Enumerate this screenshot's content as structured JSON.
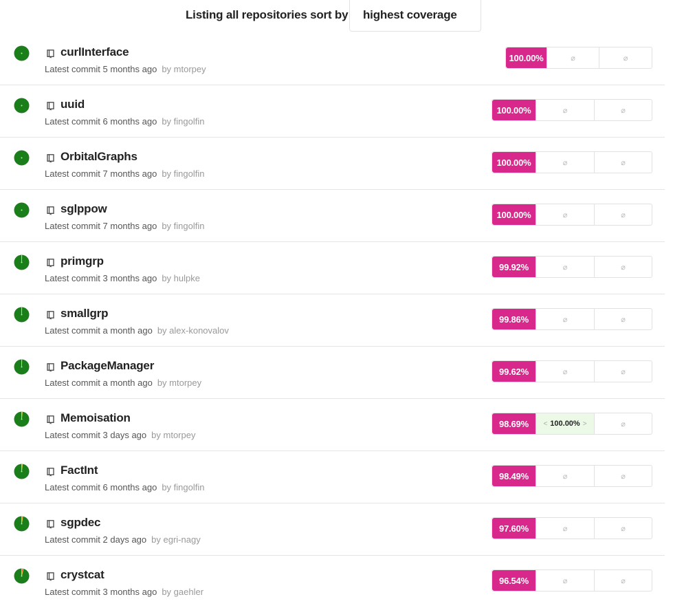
{
  "header": {
    "label": "Listing all repositories sort by",
    "sort_value": "highest coverage"
  },
  "colors": {
    "coverage_badge": "#d9288b",
    "status_green": "#1a7f1a",
    "highlight_bg": "#ebf9e6"
  },
  "icons": {
    "status": "pie-status-icon",
    "repo": "book-icon",
    "empty": "null-set-icon"
  },
  "repositories": [
    {
      "name": "curlInterface",
      "commit_text": "Latest commit 5 months ago",
      "by": "by",
      "author": "mtorpey",
      "coverage": "100.00%",
      "cell1": "⌀",
      "cell2": "⌀",
      "failing": 0
    },
    {
      "name": "uuid",
      "commit_text": "Latest commit 6 months ago",
      "by": "by",
      "author": "fingolfin",
      "coverage": "100.00%",
      "cell1": "⌀",
      "cell2": "⌀",
      "failing": 0
    },
    {
      "name": "OrbitalGraphs",
      "commit_text": "Latest commit 7 months ago",
      "by": "by",
      "author": "fingolfin",
      "coverage": "100.00%",
      "cell1": "⌀",
      "cell2": "⌀",
      "failing": 0
    },
    {
      "name": "sglppow",
      "commit_text": "Latest commit 7 months ago",
      "by": "by",
      "author": "fingolfin",
      "coverage": "100.00%",
      "cell1": "⌀",
      "cell2": "⌀",
      "failing": 0
    },
    {
      "name": "primgrp",
      "commit_text": "Latest commit 3 months ago",
      "by": "by",
      "author": "hulpke",
      "coverage": "99.92%",
      "cell1": "⌀",
      "cell2": "⌀",
      "failing": 0.0008
    },
    {
      "name": "smallgrp",
      "commit_text": "Latest commit a month ago",
      "by": "by",
      "author": "alex-konovalov",
      "coverage": "99.86%",
      "cell1": "⌀",
      "cell2": "⌀",
      "failing": 0.0014
    },
    {
      "name": "PackageManager",
      "commit_text": "Latest commit a month ago",
      "by": "by",
      "author": "mtorpey",
      "coverage": "99.62%",
      "cell1": "⌀",
      "cell2": "⌀",
      "failing": 0.0038
    },
    {
      "name": "Memoisation",
      "commit_text": "Latest commit 3 days ago",
      "by": "by",
      "author": "mtorpey",
      "coverage": "98.69%",
      "cell1_left": "<",
      "cell1": "100.00%",
      "cell1_right": ">",
      "cell2": "⌀",
      "failing": 0.0131
    },
    {
      "name": "FactInt",
      "commit_text": "Latest commit 6 months ago",
      "by": "by",
      "author": "fingolfin",
      "coverage": "98.49%",
      "cell1": "⌀",
      "cell2": "⌀",
      "failing": 0.0151
    },
    {
      "name": "sgpdec",
      "commit_text": "Latest commit 2 days ago",
      "by": "by",
      "author": "egri-nagy",
      "coverage": "97.60%",
      "cell1": "⌀",
      "cell2": "⌀",
      "failing": 0.024
    },
    {
      "name": "crystcat",
      "commit_text": "Latest commit 3 months ago",
      "by": "by",
      "author": "gaehler",
      "coverage": "96.54%",
      "cell1": "⌀",
      "cell2": "⌀",
      "failing": 0.0346
    }
  ]
}
